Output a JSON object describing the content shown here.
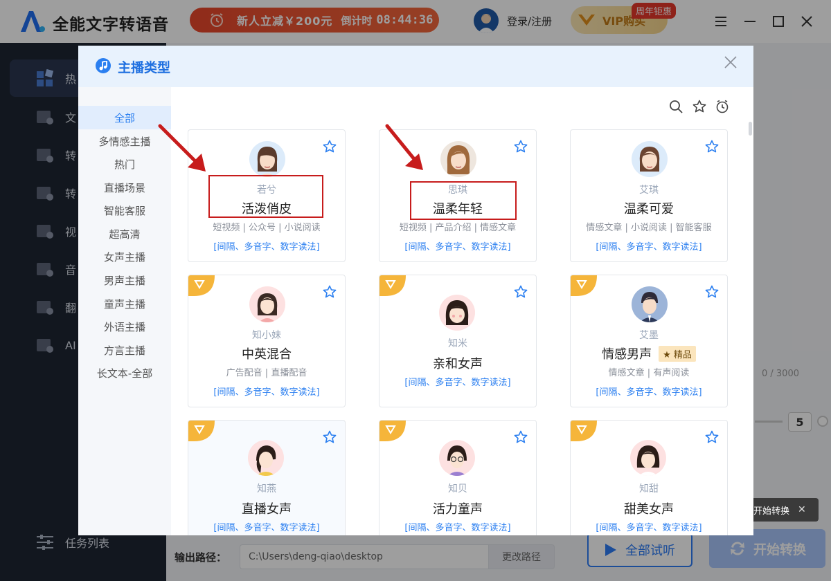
{
  "app": {
    "title": "全能文字转语音",
    "promo_text": "新人立减￥200元",
    "countdown_label": "倒计时",
    "countdown_time": "08:44:36",
    "login": "登录/注册",
    "vip_label": "VIP购买",
    "anniv_badge": "周年钜惠"
  },
  "sidebar": {
    "items": [
      {
        "label": "热",
        "icon": "hot-grid-icon"
      },
      {
        "label": "文",
        "icon": "text-doc-icon"
      },
      {
        "label": "转",
        "icon": "convert-icon"
      },
      {
        "label": "转",
        "icon": "convert-icon"
      },
      {
        "label": "视",
        "icon": "video-icon"
      },
      {
        "label": "音",
        "icon": "audio-icon"
      },
      {
        "label": "翻",
        "icon": "translate-icon"
      },
      {
        "label": "AI",
        "icon": "ai-icon"
      }
    ],
    "task_list": "任务列表"
  },
  "bottom": {
    "output_label": "输出路径：",
    "output_path": "C:\\Users\\deng-qiao\\desktop",
    "change_path": "更改路径",
    "preview_all": "全部试听",
    "start_convert": "开始转换",
    "tooltip": "开始转换",
    "tooltip_close": "✕",
    "char_count": "0 / 3000",
    "speed_value": "5"
  },
  "modal": {
    "title": "主播类型",
    "categories": [
      "全部",
      "多情感主播",
      "热门",
      "直播场景",
      "智能客服",
      "超高清",
      "女声主播",
      "男声主播",
      "童声主播",
      "外语主播",
      "方言主播",
      "长文本-全部"
    ],
    "active_category": "全部",
    "link_text": "[间隔、多音字、数字读法]",
    "cards": [
      {
        "id": "若兮",
        "style": "活泼俏皮",
        "tags": "短视频 | 公众号 | 小说阅读",
        "vip": false,
        "premium": false
      },
      {
        "id": "思琪",
        "style": "温柔年轻",
        "tags": "短视频 | 产品介绍 | 情感文章",
        "vip": false,
        "premium": false
      },
      {
        "id": "艾琪",
        "style": "温柔可爱",
        "tags": "情感文章 | 小说阅读 | 智能客服",
        "vip": false,
        "premium": false
      },
      {
        "id": "知小妹",
        "style": "中英混合",
        "tags": "广告配音 | 直播配音",
        "vip": true,
        "premium": false
      },
      {
        "id": "知米",
        "style": "亲和女声",
        "tags": "",
        "vip": true,
        "premium": false
      },
      {
        "id": "艾墨",
        "style": "情感男声",
        "tags": "情感文章 | 有声阅读",
        "vip": true,
        "premium": true,
        "premium_label": "★ 精品"
      },
      {
        "id": "知燕",
        "style": "直播女声",
        "tags": "",
        "vip": true,
        "premium": false
      },
      {
        "id": "知贝",
        "style": "活力童声",
        "tags": "",
        "vip": true,
        "premium": false
      },
      {
        "id": "知甜",
        "style": "甜美女声",
        "tags": "",
        "vip": true,
        "premium": false
      }
    ]
  },
  "colors": {
    "accent": "#2b7ff0",
    "annotation_red": "#c71c1c",
    "sidebar_bg": "#1e2633",
    "vip_gold": "#f5b53a"
  }
}
